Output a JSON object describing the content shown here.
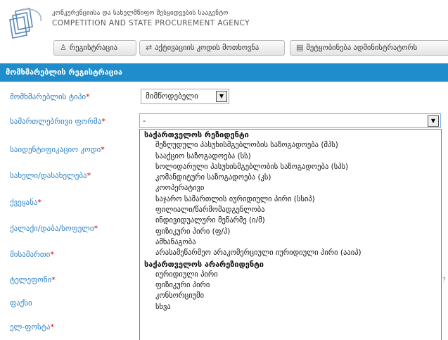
{
  "header": {
    "agency_name_ka": "კონკურენციისა და სახელმწიფო შესყიდვების სააგენტო",
    "agency_name_en": "COMPETITION AND STATE PROCUREMENT AGENCY",
    "buttons": [
      {
        "label": "რეგისტრაცია",
        "icon": "user-icon"
      },
      {
        "label": "აქტივაციის კოდის მოთხოვნა",
        "icon": "exchange-arrows-icon"
      },
      {
        "label": "შეტყობინება ადმინისტრატორს",
        "icon": "message-icon"
      }
    ]
  },
  "panel": {
    "title": "მომხმარებლის რეგისტრაცია"
  },
  "form": {
    "required_marker": "*",
    "fields": [
      {
        "label": "მომხმარებლის ტიპი"
      },
      {
        "label": "სამართლებრივი ფორმა"
      },
      {
        "label": "საიდენტიფიკაციო კოდი"
      },
      {
        "label": "სახელი/დასახელება"
      },
      {
        "label": "ქვეყანა"
      },
      {
        "label": "ქალაქი/დაბა/სოფელი"
      },
      {
        "label": "მისამართი"
      },
      {
        "label": "ტელეფონი"
      },
      {
        "label": "ფაქსი"
      },
      {
        "label": "ელ-ფოსტა"
      }
    ],
    "user_type_value": "მიმწოდებელი",
    "legal_form_value": "-"
  },
  "dropdown": {
    "options": [
      {
        "group": true,
        "label": "საქართველოს რეზიდენტი"
      },
      {
        "group": false,
        "label": "შეზღუდული პასუხისმგებლობის საზოგადოება (შპს)"
      },
      {
        "group": false,
        "label": "სააქციო საზოგადოება (სს)"
      },
      {
        "group": false,
        "label": "სოლიდარული პასუხისმგებლობის საზოგადოება (სპს)"
      },
      {
        "group": false,
        "label": "კომანდიტური საზოგადოება (კს)"
      },
      {
        "group": false,
        "label": "კოოპერატივი"
      },
      {
        "group": false,
        "label": "საჯარო სამართლის იურიდიული პირი (სსიპ)"
      },
      {
        "group": false,
        "label": "ფილიალი/წარმომადგენლობა"
      },
      {
        "group": false,
        "label": "ინდივიდუალური მეწარმე (ი/მ)"
      },
      {
        "group": false,
        "label": "ფიზიკური პირი (ფ/პ)"
      },
      {
        "group": false,
        "label": "ამხანაგობა"
      },
      {
        "group": false,
        "label": "არასამეწარმეო არაკომერციული იურიდიული პირი (ააიპ)"
      },
      {
        "group": true,
        "label": "საქართველოს არარეზიდენტი"
      },
      {
        "group": false,
        "label": "იურიდიული პირი"
      },
      {
        "group": false,
        "label": "ფიზიკური პირი"
      },
      {
        "group": false,
        "label": "კონსორციუმი"
      },
      {
        "group": false,
        "label": "სხვა"
      }
    ]
  },
  "colors": {
    "panel_header": "#1f8dcb",
    "label_text": "#2a7fbf",
    "required": "#dd0000"
  }
}
